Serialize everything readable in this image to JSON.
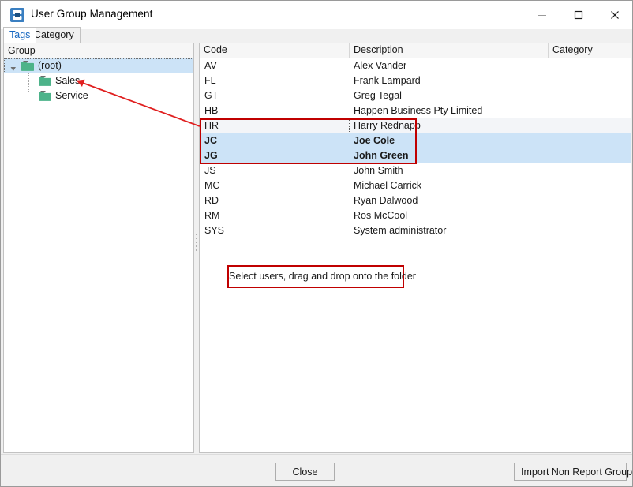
{
  "window": {
    "title": "User Group Management",
    "icon": "app-icon",
    "controls": {
      "minimize": "minimize-icon",
      "maximize": "maximize-icon",
      "close": "close-icon"
    }
  },
  "tabs": [
    {
      "label": "Tags",
      "active": true
    },
    {
      "label": "Category",
      "active": false
    }
  ],
  "left_panel": {
    "header": "Group",
    "tree": [
      {
        "label": "(root)",
        "level": 0,
        "selected": true,
        "expanded": true,
        "icon": "folder-icon"
      },
      {
        "label": "Sales",
        "level": 1,
        "selected": false,
        "icon": "folder-icon"
      },
      {
        "label": "Service",
        "level": 1,
        "selected": false,
        "icon": "folder-icon"
      }
    ]
  },
  "grid": {
    "columns": [
      "Code",
      "Description",
      "Category"
    ],
    "rows": [
      {
        "code": "AV",
        "description": "Alex Vander",
        "category": "",
        "state": "normal"
      },
      {
        "code": "FL",
        "description": "Frank Lampard",
        "category": "",
        "state": "normal"
      },
      {
        "code": "GT",
        "description": "Greg Tegal",
        "category": "",
        "state": "normal"
      },
      {
        "code": "HB",
        "description": "Happen Business Pty Limited",
        "category": "",
        "state": "normal"
      },
      {
        "code": "HR",
        "description": "Harry Rednapp",
        "category": "",
        "state": "focused"
      },
      {
        "code": "JC",
        "description": "Joe Cole",
        "category": "",
        "state": "selected"
      },
      {
        "code": "JG",
        "description": "John Green",
        "category": "",
        "state": "selected"
      },
      {
        "code": "JS",
        "description": "John Smith",
        "category": "",
        "state": "normal"
      },
      {
        "code": "MC",
        "description": "Michael Carrick",
        "category": "",
        "state": "normal"
      },
      {
        "code": "RD",
        "description": "Ryan Dalwood",
        "category": "",
        "state": "normal"
      },
      {
        "code": "RM",
        "description": "Ros McCool",
        "category": "",
        "state": "normal"
      },
      {
        "code": "SYS",
        "description": "System administrator",
        "category": "",
        "state": "normal"
      }
    ]
  },
  "annotations": {
    "callout_text": "Select users, drag and drop onto the folder",
    "arrow": "red-arrow",
    "highlight_box": "selection-highlight-box",
    "color": "#c00000"
  },
  "footer": {
    "close_label": "Close",
    "import_label": "Import Non Report Groups"
  },
  "colors": {
    "selection_blue": "#cce3f7",
    "focus_row": "#f3f5f8",
    "folder_green": "#4db38a",
    "tab_active_text": "#1566c0",
    "annotation_red": "#c00000"
  }
}
